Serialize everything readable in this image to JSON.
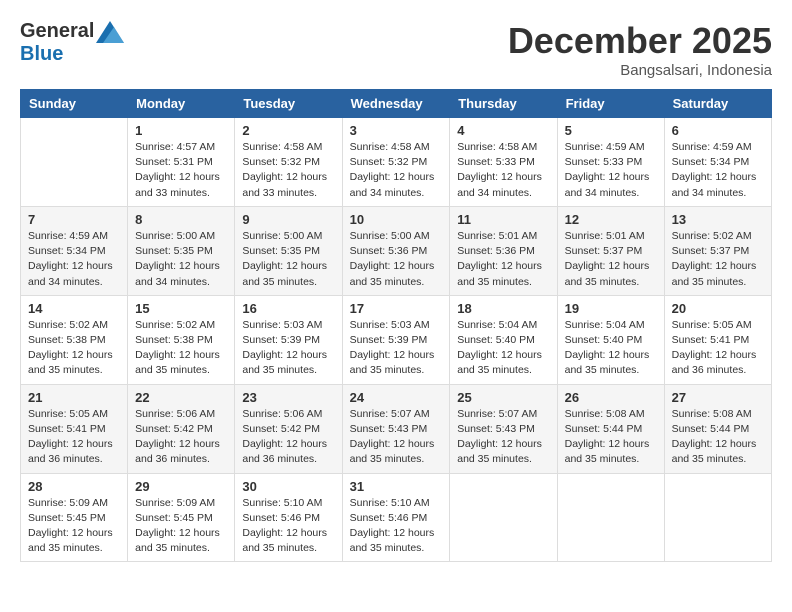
{
  "header": {
    "logo_general": "General",
    "logo_blue": "Blue",
    "title": "December 2025",
    "subtitle": "Bangsalsari, Indonesia"
  },
  "days_of_week": [
    "Sunday",
    "Monday",
    "Tuesday",
    "Wednesday",
    "Thursday",
    "Friday",
    "Saturday"
  ],
  "weeks": [
    [
      {
        "day": "",
        "info": ""
      },
      {
        "day": "1",
        "info": "Sunrise: 4:57 AM\nSunset: 5:31 PM\nDaylight: 12 hours\nand 33 minutes."
      },
      {
        "day": "2",
        "info": "Sunrise: 4:58 AM\nSunset: 5:32 PM\nDaylight: 12 hours\nand 33 minutes."
      },
      {
        "day": "3",
        "info": "Sunrise: 4:58 AM\nSunset: 5:32 PM\nDaylight: 12 hours\nand 34 minutes."
      },
      {
        "day": "4",
        "info": "Sunrise: 4:58 AM\nSunset: 5:33 PM\nDaylight: 12 hours\nand 34 minutes."
      },
      {
        "day": "5",
        "info": "Sunrise: 4:59 AM\nSunset: 5:33 PM\nDaylight: 12 hours\nand 34 minutes."
      },
      {
        "day": "6",
        "info": "Sunrise: 4:59 AM\nSunset: 5:34 PM\nDaylight: 12 hours\nand 34 minutes."
      }
    ],
    [
      {
        "day": "7",
        "info": "Sunrise: 4:59 AM\nSunset: 5:34 PM\nDaylight: 12 hours\nand 34 minutes."
      },
      {
        "day": "8",
        "info": "Sunrise: 5:00 AM\nSunset: 5:35 PM\nDaylight: 12 hours\nand 34 minutes."
      },
      {
        "day": "9",
        "info": "Sunrise: 5:00 AM\nSunset: 5:35 PM\nDaylight: 12 hours\nand 35 minutes."
      },
      {
        "day": "10",
        "info": "Sunrise: 5:00 AM\nSunset: 5:36 PM\nDaylight: 12 hours\nand 35 minutes."
      },
      {
        "day": "11",
        "info": "Sunrise: 5:01 AM\nSunset: 5:36 PM\nDaylight: 12 hours\nand 35 minutes."
      },
      {
        "day": "12",
        "info": "Sunrise: 5:01 AM\nSunset: 5:37 PM\nDaylight: 12 hours\nand 35 minutes."
      },
      {
        "day": "13",
        "info": "Sunrise: 5:02 AM\nSunset: 5:37 PM\nDaylight: 12 hours\nand 35 minutes."
      }
    ],
    [
      {
        "day": "14",
        "info": "Sunrise: 5:02 AM\nSunset: 5:38 PM\nDaylight: 12 hours\nand 35 minutes."
      },
      {
        "day": "15",
        "info": "Sunrise: 5:02 AM\nSunset: 5:38 PM\nDaylight: 12 hours\nand 35 minutes."
      },
      {
        "day": "16",
        "info": "Sunrise: 5:03 AM\nSunset: 5:39 PM\nDaylight: 12 hours\nand 35 minutes."
      },
      {
        "day": "17",
        "info": "Sunrise: 5:03 AM\nSunset: 5:39 PM\nDaylight: 12 hours\nand 35 minutes."
      },
      {
        "day": "18",
        "info": "Sunrise: 5:04 AM\nSunset: 5:40 PM\nDaylight: 12 hours\nand 35 minutes."
      },
      {
        "day": "19",
        "info": "Sunrise: 5:04 AM\nSunset: 5:40 PM\nDaylight: 12 hours\nand 35 minutes."
      },
      {
        "day": "20",
        "info": "Sunrise: 5:05 AM\nSunset: 5:41 PM\nDaylight: 12 hours\nand 36 minutes."
      }
    ],
    [
      {
        "day": "21",
        "info": "Sunrise: 5:05 AM\nSunset: 5:41 PM\nDaylight: 12 hours\nand 36 minutes."
      },
      {
        "day": "22",
        "info": "Sunrise: 5:06 AM\nSunset: 5:42 PM\nDaylight: 12 hours\nand 36 minutes."
      },
      {
        "day": "23",
        "info": "Sunrise: 5:06 AM\nSunset: 5:42 PM\nDaylight: 12 hours\nand 36 minutes."
      },
      {
        "day": "24",
        "info": "Sunrise: 5:07 AM\nSunset: 5:43 PM\nDaylight: 12 hours\nand 35 minutes."
      },
      {
        "day": "25",
        "info": "Sunrise: 5:07 AM\nSunset: 5:43 PM\nDaylight: 12 hours\nand 35 minutes."
      },
      {
        "day": "26",
        "info": "Sunrise: 5:08 AM\nSunset: 5:44 PM\nDaylight: 12 hours\nand 35 minutes."
      },
      {
        "day": "27",
        "info": "Sunrise: 5:08 AM\nSunset: 5:44 PM\nDaylight: 12 hours\nand 35 minutes."
      }
    ],
    [
      {
        "day": "28",
        "info": "Sunrise: 5:09 AM\nSunset: 5:45 PM\nDaylight: 12 hours\nand 35 minutes."
      },
      {
        "day": "29",
        "info": "Sunrise: 5:09 AM\nSunset: 5:45 PM\nDaylight: 12 hours\nand 35 minutes."
      },
      {
        "day": "30",
        "info": "Sunrise: 5:10 AM\nSunset: 5:46 PM\nDaylight: 12 hours\nand 35 minutes."
      },
      {
        "day": "31",
        "info": "Sunrise: 5:10 AM\nSunset: 5:46 PM\nDaylight: 12 hours\nand 35 minutes."
      },
      {
        "day": "",
        "info": ""
      },
      {
        "day": "",
        "info": ""
      },
      {
        "day": "",
        "info": ""
      }
    ]
  ]
}
